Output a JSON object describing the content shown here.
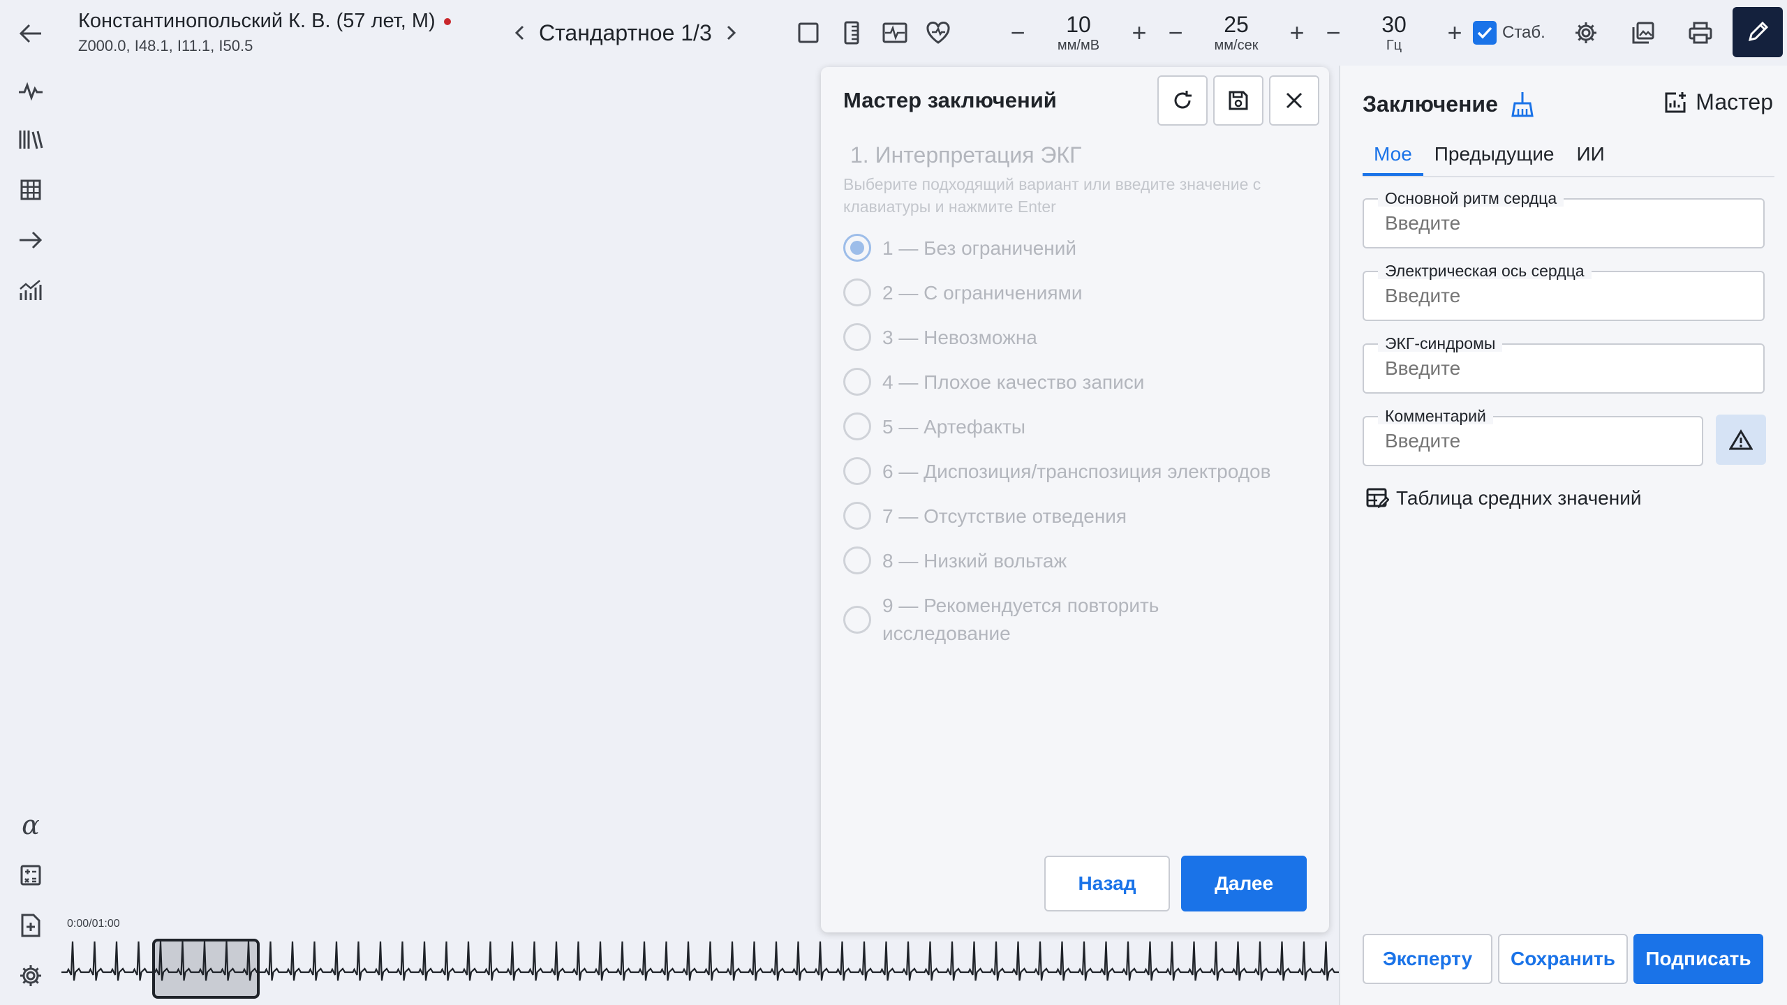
{
  "patient": {
    "name": "Константинопольский К. В. (57 лет, М)",
    "diagnoses": "Z000.0, I48.1, I11.1, I50.5"
  },
  "mode": {
    "label": "Стандартное 1/3"
  },
  "steppers": {
    "amplitude": {
      "value": "10",
      "unit": "мм/мВ"
    },
    "speed": {
      "value": "25",
      "unit": "мм/сек"
    },
    "filter": {
      "value": "30",
      "unit": "Гц"
    }
  },
  "stab": {
    "label": "Стаб.",
    "checked": true
  },
  "rail": {
    "alpha_glyph": "α"
  },
  "timeline": {
    "position": "0:00/01:00"
  },
  "wizard": {
    "title": "Мастер заключений",
    "step_title": "1. Интерпретация ЭКГ",
    "hint": "Выберите подходящий вариант или введите значение с клавиатуры и нажмите Enter",
    "options": [
      "1 — Без ограничений",
      "2 — С ограничениями",
      "3 — Невозможна",
      "4 — Плохое качество записи",
      "5 — Артефакты",
      "6 — Диспозиция/транспозиция электродов",
      "7 — Отсутствие отведения",
      "8 — Низкий вольтаж",
      "9 — Рекомендуется повторить исследование"
    ],
    "back_label": "Назад",
    "next_label": "Далее"
  },
  "panel": {
    "title": "Заключение",
    "master_label": "Мастер",
    "tabs": [
      "Мое",
      "Предыдущие",
      "ИИ"
    ],
    "fields": [
      {
        "label": "Основной ритм сердца",
        "placeholder": "Введите"
      },
      {
        "label": "Электрическая ось сердца",
        "placeholder": "Введите"
      },
      {
        "label": "ЭКГ-синдромы",
        "placeholder": "Введите"
      },
      {
        "label": "Комментарий",
        "placeholder": "Введите"
      }
    ],
    "avg_table_label": "Таблица средних значений",
    "buttons": {
      "expert": "Эксперту",
      "save": "Сохранить",
      "sign": "Подписать"
    }
  },
  "colors": {
    "accent": "#1a73e8",
    "dark": "#14213d",
    "record": "#c9262b"
  }
}
